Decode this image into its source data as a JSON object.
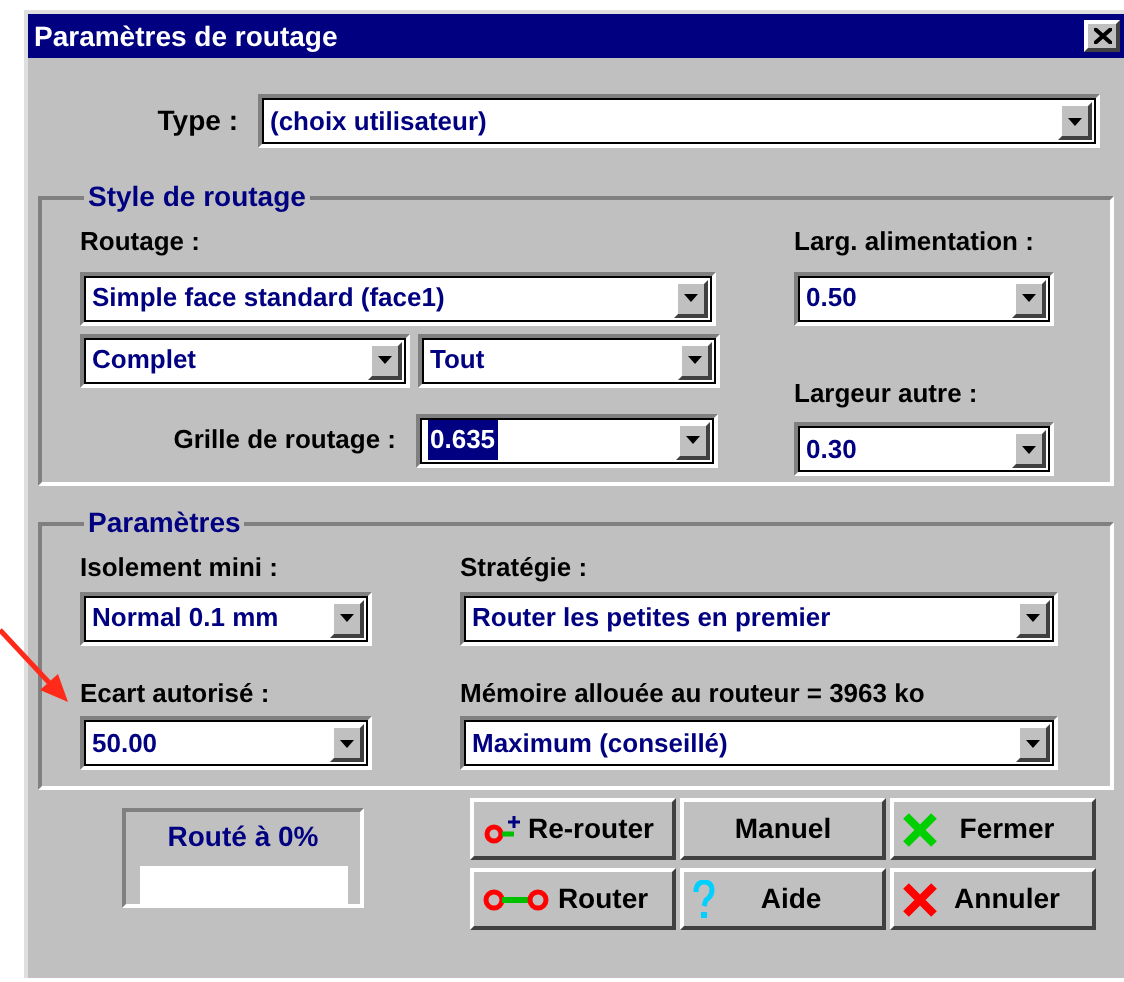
{
  "window": {
    "title": "Paramètres de routage"
  },
  "type": {
    "label": "Type :",
    "value": "(choix utilisateur)"
  },
  "style_group": {
    "title": "Style de routage",
    "routing": {
      "label": "Routage :",
      "value": "Simple face standard (face1)"
    },
    "mode": {
      "value": "Complet"
    },
    "scope": {
      "value": "Tout"
    },
    "grid": {
      "label": "Grille de routage :",
      "value": "0.635",
      "selected": true
    },
    "power_width": {
      "label": "Larg. alimentation :",
      "value": "0.50"
    },
    "other_width": {
      "label": "Largeur autre :",
      "value": "0.30"
    }
  },
  "params_group": {
    "title": "Paramètres",
    "isolation": {
      "label": "Isolement mini :",
      "value": "Normal 0.1 mm"
    },
    "tolerance": {
      "label": "Ecart autorisé :",
      "value": "50.00"
    },
    "strategy": {
      "label": "Stratégie :",
      "value": "Router les petites en premier"
    },
    "memory": {
      "label": "Mémoire allouée au routeur = 3963 ko",
      "value": "Maximum (conseillé)"
    }
  },
  "progress": {
    "label": "Routé à 0%",
    "level": 0
  },
  "buttons": [
    {
      "label": "Re-router",
      "kind": "reroute"
    },
    {
      "label": "Manuel",
      "kind": "plain"
    },
    {
      "label": "Fermer",
      "kind": "close"
    },
    {
      "label": "Router",
      "kind": "route"
    },
    {
      "label": "Aide",
      "kind": "help"
    },
    {
      "label": "Annuler",
      "kind": "cancel"
    }
  ]
}
